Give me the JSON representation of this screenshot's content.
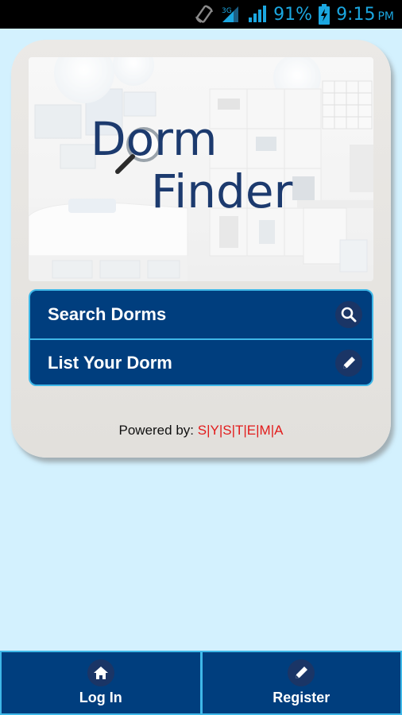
{
  "status_bar": {
    "battery_percent": "91%",
    "time": "9:15",
    "ampm": "PM",
    "icons": [
      "rotate-icon",
      "wifi-signal-icon",
      "cell-signal-icon",
      "battery-charging-icon"
    ]
  },
  "app": {
    "logo_line1": "Dorm",
    "logo_line2": "Finder"
  },
  "menu": {
    "items": [
      {
        "label": "Search Dorms",
        "icon": "search-icon"
      },
      {
        "label": "List Your Dorm",
        "icon": "pencil-icon"
      }
    ]
  },
  "footer": {
    "powered_prefix": "Powered by: ",
    "powered_brand": "S|Y|S|T|E|M|A"
  },
  "bottom_nav": {
    "login_label": "Log In",
    "register_label": "Register"
  },
  "colors": {
    "background": "#d3f1fe",
    "primary": "#003e7e",
    "accent_border": "#3fb8e8",
    "brand_red": "#e21b1b",
    "logo_blue": "#1c3a6e"
  }
}
